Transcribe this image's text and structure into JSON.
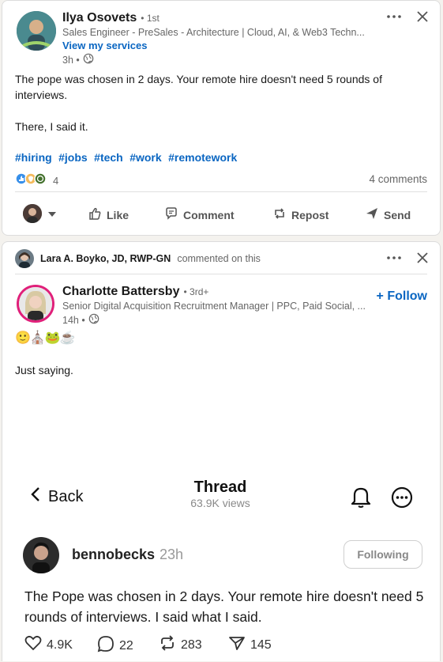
{
  "post1": {
    "author": "Ilya Osovets",
    "degree": "• 1st",
    "headline": "Sales Engineer - PreSales - Architecture | Cloud, AI, & Web3 Techn...",
    "services_link": "View my services",
    "time": "3h •",
    "paragraph1": "The pope was chosen in 2 days. Your remote hire doesn't need 5 rounds of interviews.",
    "paragraph2": "There, I said it.",
    "hashtags": [
      "#hiring",
      "#jobs",
      "#tech",
      "#work",
      "#remotework"
    ],
    "reaction_count": "4",
    "comments": "4 comments",
    "actions": {
      "like": "Like",
      "comment": "Comment",
      "repost": "Repost",
      "send": "Send"
    }
  },
  "post2": {
    "commenter": "Lara A. Boyko, JD, RWP-GN",
    "commented_text": "commented on this",
    "author": "Charlotte Battersby",
    "degree": "• 3rd+",
    "headline": "Senior Digital Acquisition Recruitment Manager | PPC, Paid Social, ...",
    "follow": "+ Follow",
    "time": "14h •",
    "emojis": "🙂⛪🐸☕",
    "text": "Just saying."
  },
  "thread": {
    "back": "Back",
    "title": "Thread",
    "views": "63.9K views",
    "username": "bennobecks",
    "time": "23h",
    "following": "Following",
    "text": "The Pope was chosen in 2 days. Your remote hire doesn't need 5 rounds of interviews. I said what I said.",
    "likes": "4.9K",
    "replies": "22",
    "reposts": "283",
    "shares": "145"
  },
  "colors": {
    "link": "#0a66c2",
    "accent_ring": "#e0207a"
  }
}
